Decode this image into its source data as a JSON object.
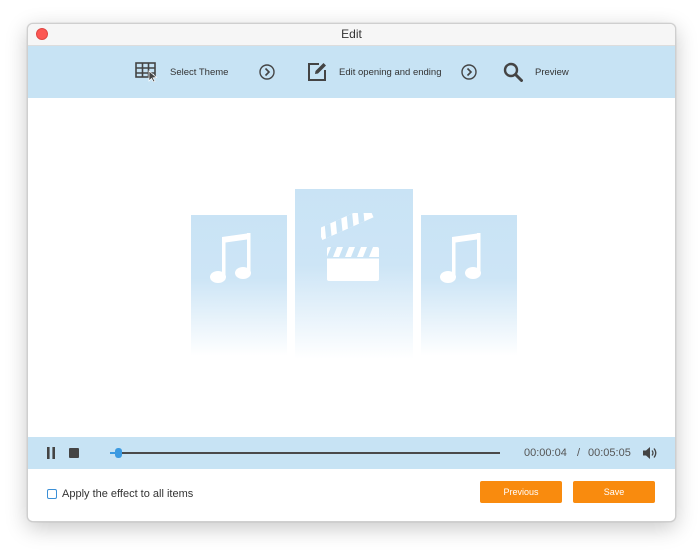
{
  "window": {
    "title": "Edit"
  },
  "steps": [
    {
      "label": "Select Theme",
      "icon": "select-theme-icon"
    },
    {
      "label": "Edit opening and ending",
      "icon": "edit-icon"
    },
    {
      "label": "Preview",
      "icon": "search-icon"
    }
  ],
  "player": {
    "current_time": "00:00:04",
    "separator": "/",
    "total_time": "00:05:05",
    "progress": 0.02
  },
  "footer": {
    "apply_all_label": "Apply the effect to all items",
    "previous_label": "Previous",
    "save_label": "Save"
  },
  "colors": {
    "accent": "#c7e3f4",
    "button": "#f98b0e",
    "slider": "#3b9ae1"
  }
}
